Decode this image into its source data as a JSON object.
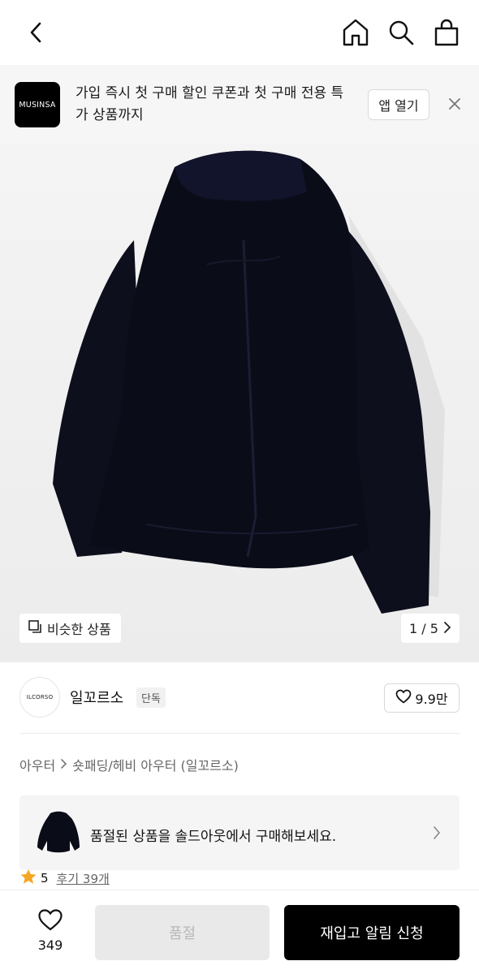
{
  "banner": {
    "logo_text": "MUSINSA",
    "message": "가입 즉시 첫 구매 할인 쿠폰과 첫 구매 전용 특가 상품까지",
    "open_label": "앱 열기"
  },
  "hero": {
    "similar_label": "비슷한 상품",
    "pager": "1 / 5",
    "current_page": 1,
    "total_pages": 5
  },
  "brand": {
    "logo_text": "ILCORSO",
    "name": "일꼬르소",
    "tag": "단독",
    "likes": "9.9만"
  },
  "breadcrumb": {
    "category": "아우터",
    "subcategory": "숏패딩/헤비 아우터 (일꼬르소)"
  },
  "soldout_notice": {
    "message": "품절된 상품을 솔드아웃에서 구매해보세요."
  },
  "rating": {
    "score": "5",
    "reviews": "후기 39개"
  },
  "bottom_bar": {
    "wish_count": "349",
    "soldout_label": "품절",
    "restock_label": "재입고 알림 신청"
  },
  "colors": {
    "accent_star": "#f5a623",
    "primary_button": "#000000",
    "disabled_button": "#e9e9e9"
  },
  "icons": [
    "back-icon",
    "home-icon",
    "search-icon",
    "cart-icon",
    "close-icon",
    "copy-icon",
    "chevron-right-icon",
    "heart-icon",
    "star-icon"
  ]
}
